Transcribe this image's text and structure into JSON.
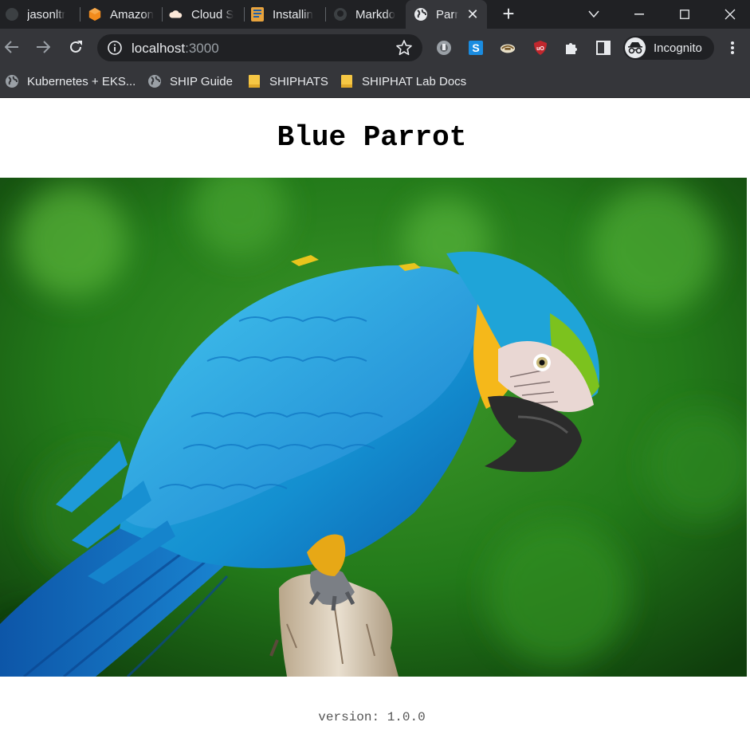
{
  "browser": {
    "tabs": [
      {
        "label": "jasonltr",
        "icon": "github-icon"
      },
      {
        "label": "Amazon",
        "icon": "aws-icon"
      },
      {
        "label": "Cloud S",
        "icon": "cloud-icon"
      },
      {
        "label": "Installin",
        "icon": "docs-icon"
      },
      {
        "label": "Markdo",
        "icon": "github-icon"
      },
      {
        "label": "Parr",
        "icon": "globe-icon",
        "active": true
      }
    ],
    "address": {
      "host": "localhost",
      "port": ":3000"
    },
    "profile_label": "Incognito",
    "bookmarks": [
      {
        "label": "Kubernetes + EKS...",
        "icon": "globe-icon"
      },
      {
        "label": "SHIP Guide",
        "icon": "globe-icon"
      },
      {
        "label": "SHIPHATS",
        "icon": "folder-icon"
      },
      {
        "label": "SHIPHAT Lab Docs",
        "icon": "folder-icon"
      }
    ]
  },
  "page": {
    "title": "Blue Parrot",
    "image": {
      "subject": "blue-and-gold macaw perched on a branch"
    },
    "version": "version: 1.0.0"
  },
  "colors": {
    "chrome_dark": "#202124",
    "chrome_toolbar": "#35363a",
    "chrome_text": "#e8eaed",
    "macaw_blue": "#1aa3d9",
    "macaw_yellow": "#f5b81a",
    "foliage_green": "#2e7d1f"
  }
}
